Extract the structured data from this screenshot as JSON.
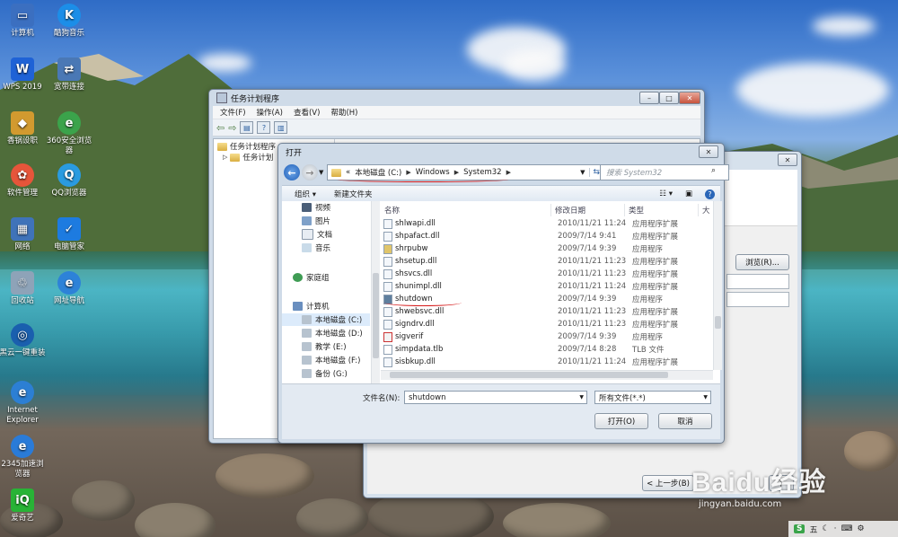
{
  "desktop": {
    "icons": [
      {
        "label": "计算机",
        "icon": "computer-icon",
        "color": "#3b6fc0"
      },
      {
        "label": "酷狗音乐",
        "icon": "kugou-icon",
        "color": "#1c8ee8"
      },
      {
        "label": "WPS 2019",
        "icon": "wps-icon",
        "color": "#1f62d6"
      },
      {
        "label": "宽带连接",
        "icon": "broadband-icon",
        "color": "#4a78b5"
      },
      {
        "label": "香锅设职",
        "icon": "app-icon",
        "color": "#d29a2f"
      },
      {
        "label": "360安全浏览器",
        "icon": "browser-360-icon",
        "color": "#3ba34b"
      },
      {
        "label": "软件管理",
        "icon": "software-manager-icon",
        "color": "#e6553a"
      },
      {
        "label": "QQ浏览器",
        "icon": "qq-browser-icon",
        "color": "#2a9be0"
      },
      {
        "label": "网络",
        "icon": "network-icon",
        "color": "#3f73b9"
      },
      {
        "label": "电脑管家",
        "icon": "pc-manager-icon",
        "color": "#1d7be0"
      },
      {
        "label": "回收站",
        "icon": "recycle-bin-icon",
        "color": "#8ea3b8"
      },
      {
        "label": "网址导航",
        "icon": "ie-nav-icon",
        "color": "#2d82d8"
      },
      {
        "label": "黑云一键重装",
        "icon": "reinstall-icon",
        "color": "#1a5fae"
      },
      {
        "label": "Internet Explorer",
        "icon": "ie-icon",
        "color": "#2c7fd4"
      },
      {
        "label": "2345加速浏览器",
        "icon": "browser-2345-icon",
        "color": "#2a7bd8"
      },
      {
        "label": "爱奇艺",
        "icon": "iqiyi-icon",
        "color": "#28b336"
      }
    ]
  },
  "task_window": {
    "title": "任务计划程序",
    "menu": [
      "文件(F)",
      "操作(A)",
      "查看(V)",
      "帮助(H)"
    ],
    "tree": [
      "任务计划程序",
      "任务计划"
    ]
  },
  "wizard_window": {
    "browse_button": "浏览(R)...",
    "back_button": "< 上一步(B)",
    "next_button": "下"
  },
  "open_dialog": {
    "title": "打开",
    "breadcrumb": {
      "prefix": "«",
      "items": [
        "本地磁盘 (C:)",
        "Windows",
        "System32"
      ]
    },
    "search_placeholder": "搜索 System32",
    "organize_label": "组织",
    "new_folder_label": "新建文件夹",
    "nav_items": [
      {
        "label": "视频",
        "icon": "video-icon"
      },
      {
        "label": "图片",
        "icon": "picture-icon"
      },
      {
        "label": "文档",
        "icon": "document-icon"
      },
      {
        "label": "音乐",
        "icon": "music-icon"
      },
      {
        "label": "家庭组",
        "icon": "homegroup-icon"
      },
      {
        "label": "计算机",
        "icon": "computer-icon"
      },
      {
        "label": "本地磁盘 (C:)",
        "icon": "drive-icon",
        "selected": true
      },
      {
        "label": "本地磁盘 (D:)",
        "icon": "drive-icon"
      },
      {
        "label": "教学 (E:)",
        "icon": "drive-icon"
      },
      {
        "label": "本地磁盘 (F:)",
        "icon": "drive-icon"
      },
      {
        "label": "备份 (G:)",
        "icon": "drive-icon"
      }
    ],
    "columns": [
      "名称",
      "修改日期",
      "类型",
      "大"
    ],
    "files": [
      {
        "name": "shlwapi.dll",
        "date": "2010/11/21 11:24",
        "type": "应用程序扩展"
      },
      {
        "name": "shpafact.dll",
        "date": "2009/7/14 9:41",
        "type": "应用程序扩展"
      },
      {
        "name": "shrpubw",
        "date": "2009/7/14 9:39",
        "type": "应用程序"
      },
      {
        "name": "shsetup.dll",
        "date": "2010/11/21 11:23",
        "type": "应用程序扩展"
      },
      {
        "name": "shsvcs.dll",
        "date": "2010/11/21 11:23",
        "type": "应用程序扩展"
      },
      {
        "name": "shunimpl.dll",
        "date": "2010/11/21 11:24",
        "type": "应用程序扩展"
      },
      {
        "name": "shutdown",
        "date": "2009/7/14 9:39",
        "type": "应用程序"
      },
      {
        "name": "shwebsvc.dll",
        "date": "2010/11/21 11:23",
        "type": "应用程序扩展"
      },
      {
        "name": "signdrv.dll",
        "date": "2010/11/21 11:23",
        "type": "应用程序扩展"
      },
      {
        "name": "sigverif",
        "date": "2009/7/14 9:39",
        "type": "应用程序"
      },
      {
        "name": "simpdata.tlb",
        "date": "2009/7/14 8:28",
        "type": "TLB 文件"
      },
      {
        "name": "sisbkup.dll",
        "date": "2010/11/21 11:24",
        "type": "应用程序扩展"
      }
    ],
    "filename_label": "文件名(N):",
    "filename_value": "shutdown",
    "filetype_value": "所有文件(*.*)",
    "open_button": "打开(O)",
    "cancel_button": "取消"
  },
  "tray": {
    "items": [
      "S",
      "五",
      "☾",
      "·",
      "⌨",
      "⚙"
    ]
  },
  "watermark": {
    "logo": "Baidu经验",
    "url": "jingyan.baidu.com"
  }
}
